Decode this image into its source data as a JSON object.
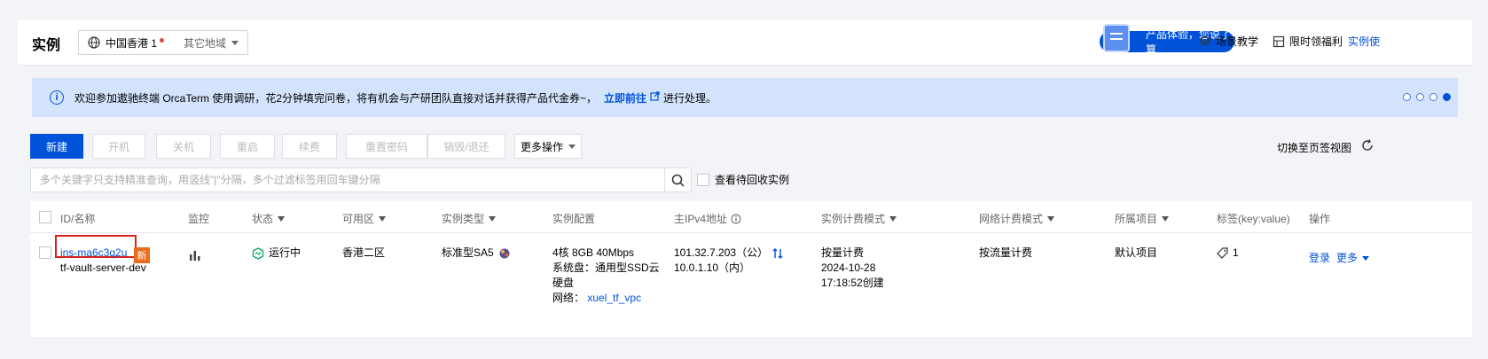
{
  "header": {
    "title": "实例",
    "region": "中国香港 1",
    "other_region": "其它地域",
    "feedback": "产品体验，您说了算",
    "scene_tutorial": "场景教学",
    "limited_offer": "限时领福利",
    "instance_link": "实例使"
  },
  "banner": {
    "text": "欢迎参加遨驰终端 OrcaTerm 使用调研，花2分钟填完问卷，将有机会与产研团队直接对话并获得产品代金券~，",
    "link": "立即前往",
    "suffix": "进行处理。"
  },
  "toolbar": {
    "new": "新建",
    "start": "开机",
    "shutdown": "关机",
    "restart": "重启",
    "renew": "续费",
    "reset_password": "重置密码",
    "destroy": "销毁/退还",
    "more_ops": "更多操作",
    "switch_view": "切换至页签视图"
  },
  "search": {
    "placeholder": "多个关键字只支持精准查询，用竖线\"|\"分隔，多个过滤标签用回车键分隔",
    "recycle_label": "查看待回收实例"
  },
  "table": {
    "headers": {
      "id_name": "ID/名称",
      "monitor": "监控",
      "status": "状态",
      "zone": "可用区",
      "type": "实例类型",
      "config": "实例配置",
      "ipv4": "主IPv4地址",
      "billing": "实例计费模式",
      "net_billing": "网络计费模式",
      "project": "所属项目",
      "tags": "标签(key:value)",
      "ops": "操作"
    },
    "row": {
      "id": "ins-ma6c3q2u",
      "new_badge": "新",
      "name": "tf-vault-server-dev",
      "status": "运行中",
      "zone": "香港二区",
      "type": "标准型SA5",
      "config_line1": "4核 8GB 40Mbps",
      "config_line2": "系统盘：通用型SSD云",
      "config_line3": "硬盘",
      "config_net_label": "网络：",
      "config_net": "xuel_tf_vpc",
      "ip_public": "101.32.7.203（公）",
      "ip_private": "10.0.1.10（内）",
      "billing": "按量计费",
      "created_date": "2024-10-28",
      "created_time": "17:18:52创建",
      "net_billing": "按流量计费",
      "project": "默认项目",
      "tag_count": "1",
      "login": "登录",
      "more": "更多"
    }
  },
  "colors": {
    "primary": "#0052d9",
    "banner_bg": "#d4e3fc",
    "highlight_box": "#d9221c",
    "new_badge": "#e86d1c",
    "running": "#0aa35f"
  }
}
